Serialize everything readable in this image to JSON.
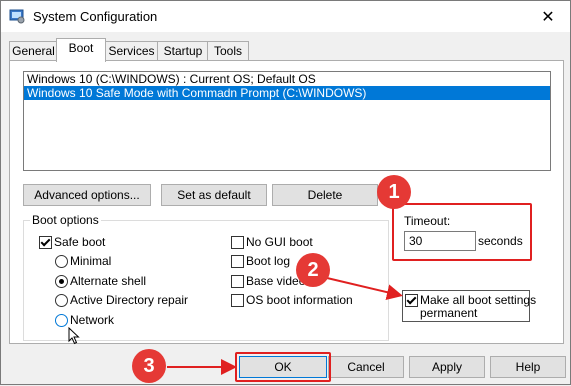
{
  "window": {
    "title": "System Configuration",
    "close_glyph": "✕"
  },
  "tabs": [
    {
      "label": "General"
    },
    {
      "label": "Boot"
    },
    {
      "label": "Services"
    },
    {
      "label": "Startup"
    },
    {
      "label": "Tools"
    }
  ],
  "os_list": [
    {
      "label": "Windows 10 (C:\\WINDOWS) : Current OS; Default OS",
      "selected": false
    },
    {
      "label": "Windows 10 Safe Mode with Commadn Prompt (C:\\WINDOWS)",
      "selected": true
    }
  ],
  "os_buttons": {
    "advanced": "Advanced options...",
    "set_default": "Set as default",
    "delete": "Delete"
  },
  "boot_options": {
    "legend": "Boot options",
    "safe_boot": "Safe boot",
    "minimal": "Minimal",
    "alternate_shell": "Alternate shell",
    "active_directory": "Active Directory repair",
    "network": "Network",
    "no_gui": "No GUI boot",
    "boot_log": "Boot log",
    "base_video": "Base video",
    "os_boot_info": "OS boot information"
  },
  "timeout": {
    "label": "Timeout:",
    "value": "30",
    "unit": "seconds"
  },
  "make_permanent": {
    "line1": "Make all boot settings",
    "line2": "permanent"
  },
  "footer": {
    "ok": "OK",
    "cancel": "Cancel",
    "apply": "Apply",
    "help": "Help"
  },
  "annotations": {
    "badge1": "1",
    "badge2": "2",
    "badge3": "3",
    "color": "#e53935"
  }
}
